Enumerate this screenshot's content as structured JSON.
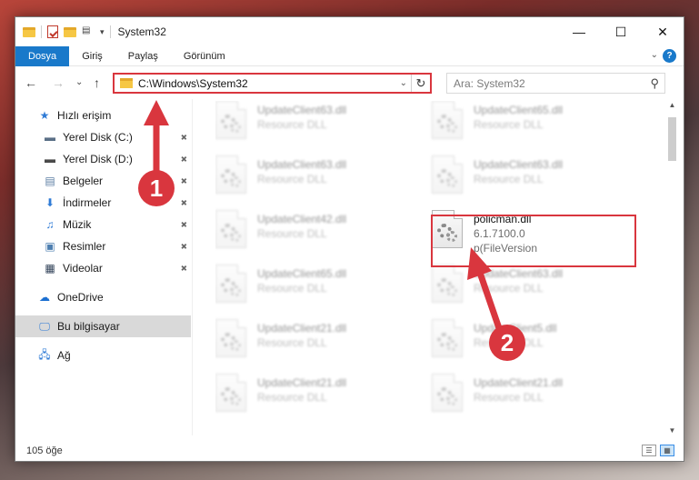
{
  "window": {
    "title": "System32",
    "controls": {
      "minimize": "—",
      "maximize": "☐",
      "close": "✕"
    }
  },
  "ribbon": {
    "tabs": [
      "Dosya",
      "Giriş",
      "Paylaş",
      "Görünüm"
    ],
    "expand": "⌄",
    "help": "?"
  },
  "address": {
    "path": "C:\\Windows\\System32",
    "refresh": "↻",
    "dropdown": "⌄"
  },
  "nav": {
    "back": "←",
    "forward": "→",
    "recent": "⌄",
    "up": "↑"
  },
  "search": {
    "placeholder": "Ara: System32",
    "icon": "⚲"
  },
  "sidebar": {
    "items": [
      {
        "label": "Hızlı erişim",
        "icon": "star-icon",
        "glyph": "★",
        "color": "#2f7bd6",
        "pinned": false,
        "indent": 0
      },
      {
        "label": "Yerel Disk (C:)",
        "icon": "drive-icon",
        "glyph": "▬",
        "color": "#5a6f86",
        "pinned": true,
        "indent": 1
      },
      {
        "label": "Yerel Disk (D:)",
        "icon": "drive-icon",
        "glyph": "▬",
        "color": "#4a4a4a",
        "pinned": true,
        "indent": 1
      },
      {
        "label": "Belgeler",
        "icon": "documents-icon",
        "glyph": "▤",
        "color": "#5b7ea3",
        "pinned": true,
        "indent": 1
      },
      {
        "label": "İndirmeler",
        "icon": "download-icon",
        "glyph": "⬇",
        "color": "#2f7bd6",
        "pinned": true,
        "indent": 1
      },
      {
        "label": "Müzik",
        "icon": "music-icon",
        "glyph": "♫",
        "color": "#2f7bd6",
        "pinned": true,
        "indent": 1
      },
      {
        "label": "Resimler",
        "icon": "pictures-icon",
        "glyph": "▣",
        "color": "#4e7fb0",
        "pinned": true,
        "indent": 1
      },
      {
        "label": "Videolar",
        "icon": "videos-icon",
        "glyph": "▦",
        "color": "#2d3e55",
        "pinned": true,
        "indent": 1
      },
      {
        "label": "OneDrive",
        "icon": "onedrive-icon",
        "glyph": "☁",
        "color": "#1b6fd1",
        "pinned": false,
        "indent": 0
      },
      {
        "label": "Bu bilgisayar",
        "icon": "computer-icon",
        "glyph": "🖵",
        "color": "#2f7bd6",
        "pinned": false,
        "indent": 0,
        "selected": true
      },
      {
        "label": "Ağ",
        "icon": "network-icon",
        "glyph": "🖧",
        "color": "#2f7bd6",
        "pinned": false,
        "indent": 0
      }
    ],
    "pin_glyph": "📌"
  },
  "files": [
    {
      "name": "UpdateClient63.dll",
      "sub": "Resource DLL",
      "blurred": true
    },
    {
      "name": "UpdateClient65.dll",
      "sub": "Resource DLL",
      "blurred": true
    },
    {
      "name": "UpdateClient63.dll",
      "sub": "Resource DLL",
      "blurred": true
    },
    {
      "name": "UpdateClient63.dll",
      "sub": "Resource DLL",
      "blurred": true
    },
    {
      "name": "UpdateClient42.dll",
      "sub": "Resource DLL",
      "blurred": true
    },
    {
      "name": "policman.dll",
      "sub": "6.1.7100.0",
      "sub2": "p(FileVersion",
      "blurred": false
    },
    {
      "name": "UpdateClient65.dll",
      "sub": "Resource DLL",
      "blurred": true
    },
    {
      "name": "UpdateClient63.dll",
      "sub": "Resource DLL",
      "blurred": true
    },
    {
      "name": "UpdateClient21.dll",
      "sub": "Resource DLL",
      "blurred": true
    },
    {
      "name": "UpdateClient5.dll",
      "sub": "Resource DLL",
      "blurred": true
    },
    {
      "name": "UpdateClient21.dll",
      "sub": "Resource DLL",
      "blurred": true
    },
    {
      "name": "UpdateClient21.dll",
      "sub": "Resource DLL",
      "blurred": true
    }
  ],
  "status": {
    "count": "105 öğe"
  },
  "annotations": [
    {
      "number": "1"
    },
    {
      "number": "2"
    }
  ],
  "colors": {
    "accent": "#1979ca",
    "highlight": "#d9363e",
    "annotation": "#d9363e"
  }
}
